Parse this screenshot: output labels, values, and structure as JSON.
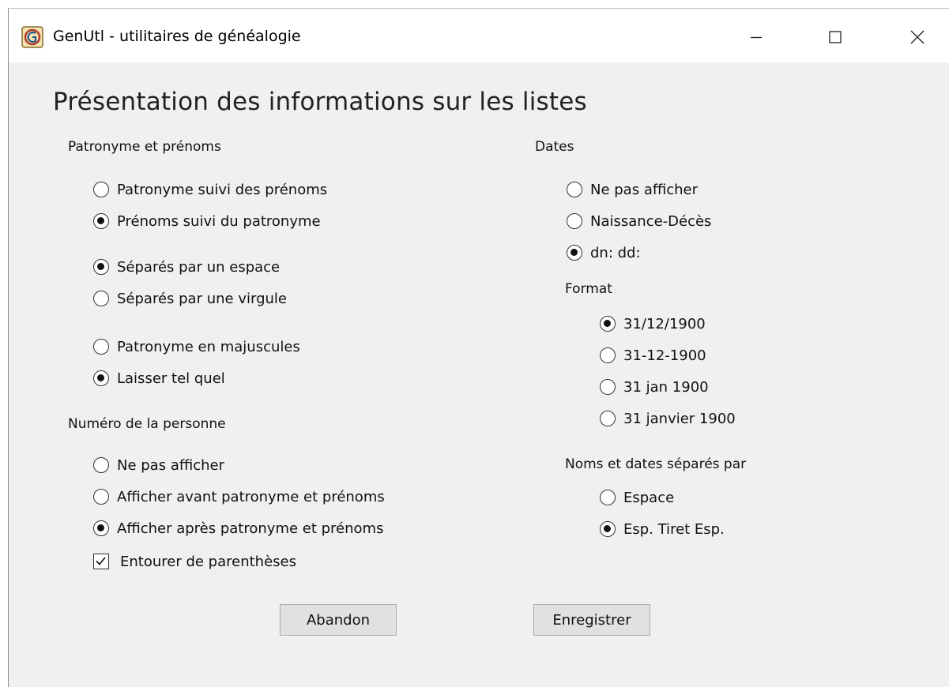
{
  "window": {
    "title": "GenUtl - utilitaires de généalogie",
    "app_icon": "genutl-app-icon",
    "controls": [
      "minimize-icon",
      "maximize-icon",
      "close-icon"
    ]
  },
  "page": {
    "heading": "Présentation des informations sur les listes"
  },
  "name_section": {
    "label": "Patronyme et prénoms",
    "order_options": [
      {
        "label": "Patronyme suivi des prénoms",
        "selected": false
      },
      {
        "label": "Prénoms suivi du patronyme",
        "selected": true
      }
    ],
    "separator_options": [
      {
        "label": "Séparés par un espace",
        "selected": true
      },
      {
        "label": "Séparés par une virgule",
        "selected": false
      }
    ],
    "case_options": [
      {
        "label": "Patronyme en majuscules",
        "selected": false
      },
      {
        "label": "Laisser tel quel",
        "selected": true
      }
    ]
  },
  "number_section": {
    "label": "Numéro de la personne",
    "options": [
      {
        "label": "Ne pas afficher",
        "selected": false
      },
      {
        "label": "Afficher avant patronyme et prénoms",
        "selected": false
      },
      {
        "label": "Afficher après patronyme et prénoms",
        "selected": true
      }
    ],
    "parentheses_checkbox": {
      "label": "Entourer de parenthèses",
      "checked": true
    }
  },
  "dates_section": {
    "label": "Dates",
    "options": [
      {
        "label": "Ne pas afficher",
        "selected": false
      },
      {
        "label": "Naissance-Décès",
        "selected": false
      },
      {
        "label": "dn: dd:",
        "selected": true
      }
    ],
    "format_label": "Format",
    "format_options": [
      {
        "label": "31/12/1900",
        "selected": true
      },
      {
        "label": "31-12-1900",
        "selected": false
      },
      {
        "label": "31 jan 1900",
        "selected": false
      },
      {
        "label": "31 janvier 1900",
        "selected": false
      }
    ],
    "separator_label": "Noms et dates séparés par",
    "separator_options": [
      {
        "label": "Espace",
        "selected": false
      },
      {
        "label": "Esp. Tiret Esp.",
        "selected": true
      }
    ]
  },
  "buttons": {
    "cancel_label": "Abandon",
    "save_label": "Enregistrer"
  }
}
